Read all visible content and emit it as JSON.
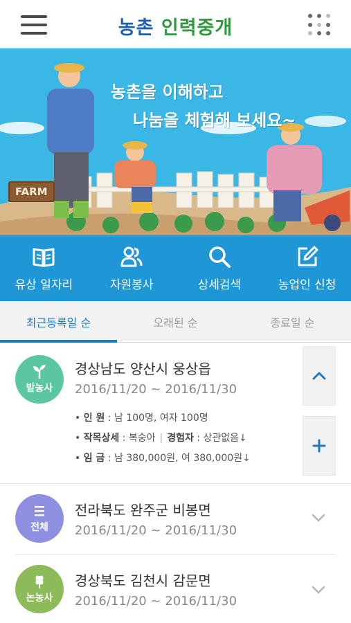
{
  "header": {
    "logo_part1": "농촌",
    "logo_part2": "인력중개"
  },
  "banner": {
    "line1": "농촌을 이해하고",
    "line2": "나눔을 체험해 보세요~",
    "sign": "FARM",
    "sky_color": "#3bb7e6"
  },
  "menu": {
    "items": [
      {
        "label": "유상 일자리",
        "icon": "book-icon"
      },
      {
        "label": "자원봉사",
        "icon": "people-icon"
      },
      {
        "label": "상세검색",
        "icon": "search-icon"
      },
      {
        "label": "농업인 신청",
        "icon": "edit-icon"
      }
    ],
    "bg_color": "#1f96d6"
  },
  "tabs": [
    {
      "label": "최근등록일 순",
      "active": true
    },
    {
      "label": "오래된 순",
      "active": false
    },
    {
      "label": "종료일 순",
      "active": false
    }
  ],
  "listings": [
    {
      "badge": "밭농사",
      "badge_color": "#5cc6a0",
      "badge_icon": "sprout-icon",
      "title": "경상남도 양산시 웅상읍",
      "date": "2016/11/20 ~ 2016/11/30",
      "expanded": true,
      "details": {
        "personnel_label": "인 원",
        "personnel_value": "남 100명, 여자 100명",
        "crop_label": "작목상세",
        "crop_value": "복숭아",
        "experience_label": "경험자",
        "experience_value": "상관없음",
        "wage_label": "임 금",
        "wage_value": "남 380,000원, 여 380,000원"
      }
    },
    {
      "badge": "전체",
      "badge_color": "#8e8fe0",
      "badge_icon": "menu-lines-icon",
      "title": "전라북도 완주군 비봉면",
      "date": "2016/11/20 ~ 2016/11/30",
      "expanded": false
    },
    {
      "badge": "논농사",
      "badge_color": "#8dbb5a",
      "badge_icon": "rice-icon",
      "title": "경상북도 김천시 감문면",
      "date": "2016/11/20 ~ 2016/11/30",
      "expanded": false
    }
  ]
}
